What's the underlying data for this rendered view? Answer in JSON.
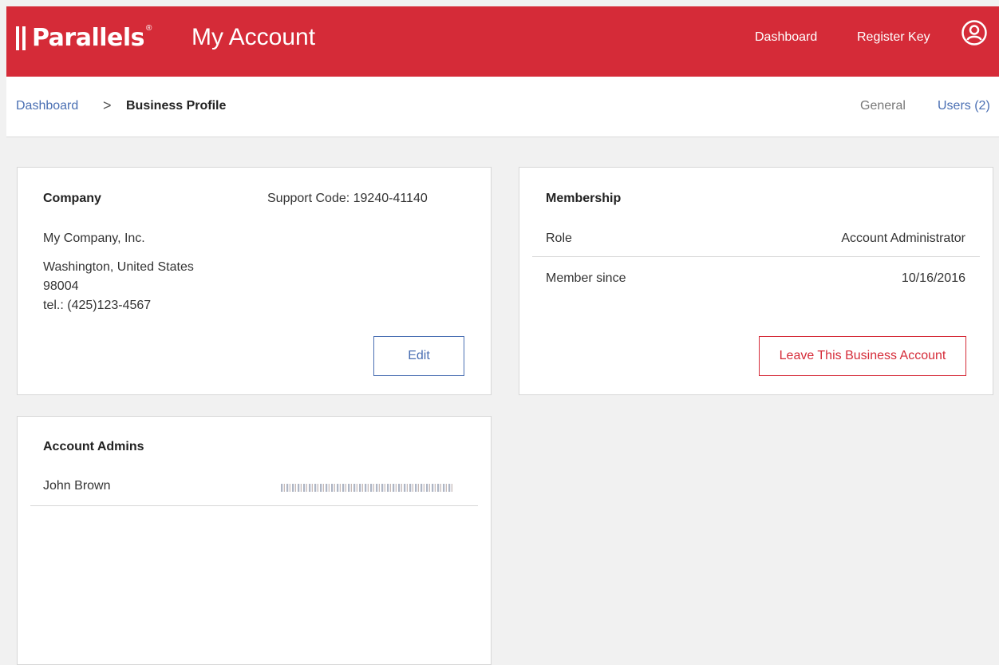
{
  "header": {
    "logo_text": "Parallels",
    "logo_reg": "®",
    "app_title": "My Account",
    "nav": {
      "dashboard": "Dashboard",
      "register_key": "Register Key"
    },
    "brand_color": "#d52b38"
  },
  "breadcrumb": {
    "root": "Dashboard",
    "separator": ">",
    "current": "Business Profile"
  },
  "tabs": {
    "general": "General",
    "users": "Users (2)"
  },
  "company": {
    "title": "Company",
    "support_code": "Support Code: 19240-41140",
    "name": "My Company, Inc.",
    "address_line": "Washington, United States",
    "zip": "98004",
    "phone": "tel.: (425)123-4567",
    "edit_label": "Edit"
  },
  "membership": {
    "title": "Membership",
    "role_label": "Role",
    "role_value": "Account Administrator",
    "since_label": "Member since",
    "since_value": "10/16/2016",
    "leave_label": "Leave This Business Account"
  },
  "admins": {
    "title": "Account Admins",
    "rows": [
      {
        "name": "John Brown"
      }
    ]
  }
}
